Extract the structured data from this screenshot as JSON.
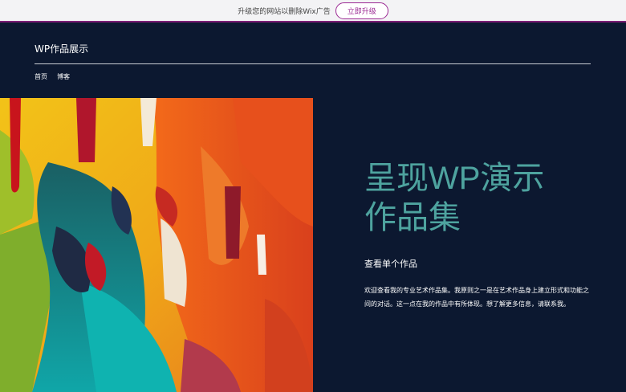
{
  "banner": {
    "text": "升级您的网站以删除Wix广告",
    "upgrade_label": "立即升级"
  },
  "header": {
    "site_title": "WP作品展示",
    "nav": [
      {
        "label": "首页"
      },
      {
        "label": "博客"
      }
    ]
  },
  "hero": {
    "heading_line1": "呈现WP演示",
    "heading_line2": "作品集",
    "subheading": "查看单个作品",
    "body": "欢迎查看我的专业艺术作品集。我原则之一是在艺术作品身上建立形式和功能之间的对话。这一点在我的作品中有所体现。想了解更多信息，请联系我。",
    "image_icon": "abstract-painting-image"
  },
  "colors": {
    "background": "#0c1830",
    "accent": "#4ea39f",
    "banner_border": "#7b1c74",
    "upgrade_button": "#9b2993"
  }
}
